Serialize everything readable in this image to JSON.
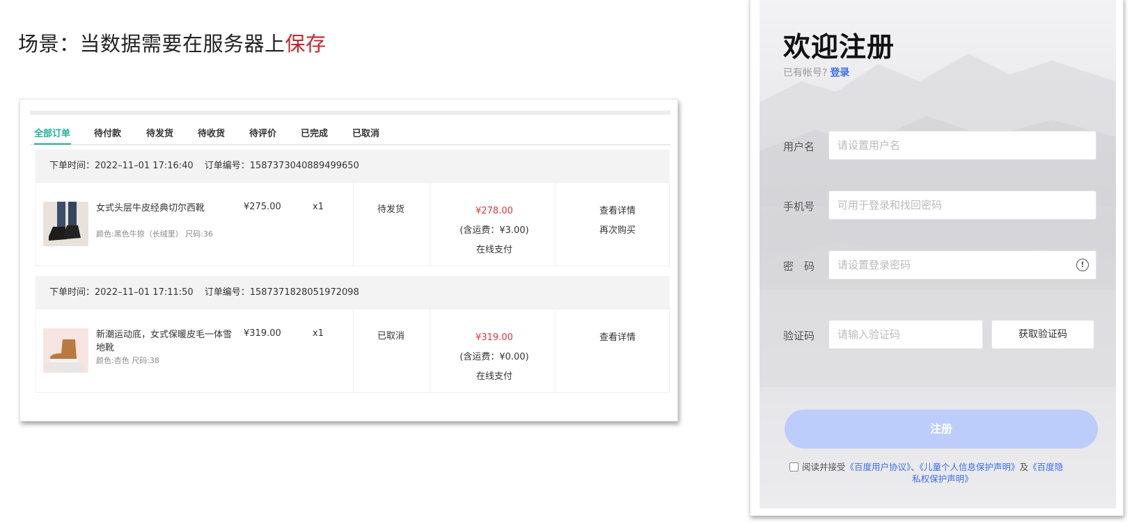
{
  "heading": {
    "text": "场景：当数据需要在服务器上",
    "highlight": "保存"
  },
  "orders": {
    "tabs": [
      "全部订单",
      "待付款",
      "待发货",
      "待收货",
      "待评价",
      "已完成",
      "已取消"
    ],
    "list": [
      {
        "time": "下单时间：2022–11–01 17:16:40",
        "order_no": "订单编号：1587373040889499650",
        "product_name": "女式头层牛皮经典切尔西靴",
        "product_attr": "颜色:黑色牛猄（长绒里） 尺码:36",
        "price": "¥275.00",
        "qty": "x1",
        "status": "待发货",
        "total": "¥278.00",
        "shipping": "(含运费：¥3.00)",
        "pay_method": "在线支付",
        "actions": [
          "查看详情",
          "再次购买"
        ]
      },
      {
        "time": "下单时间：2022–11–01 17:11:50",
        "order_no": "订单编号：1587371828051972098",
        "product_name": "新潮运动底，女式保暖皮毛一体雪地靴",
        "product_attr": "颜色:杏色 尺码:38",
        "price": "¥319.00",
        "qty": "x1",
        "status": "已取消",
        "total": "¥319.00",
        "shipping": "(含运费：¥0.00)",
        "pay_method": "在线支付",
        "actions": [
          "查看详情"
        ]
      }
    ]
  },
  "register": {
    "title": "欢迎注册",
    "have_account": "已有帐号?",
    "login_link": "登录",
    "fields": {
      "username": {
        "label": "用户名",
        "placeholder": "请设置用户名"
      },
      "phone": {
        "label": "手机号",
        "placeholder": "可用于登录和找回密码"
      },
      "password": {
        "label": "密　码",
        "placeholder": "请设置登录密码"
      },
      "code": {
        "label": "验证码",
        "placeholder": "请输入验证码"
      }
    },
    "get_code": "获取验证码",
    "submit": "注册",
    "agree_prefix": "阅读并接受",
    "agree_link1": "《百度用户协议》",
    "agree_sep": "、",
    "agree_link2": "《儿童个人信息保护声明》",
    "agree_and": "及",
    "agree_link3a": "《百度隐",
    "agree_link3b": "私权保护声明》",
    "colors": {
      "accent": "#1fb29b",
      "price_red": "#e3343c",
      "link_blue": "#3a6df0",
      "title_red": "#c0282d"
    }
  }
}
